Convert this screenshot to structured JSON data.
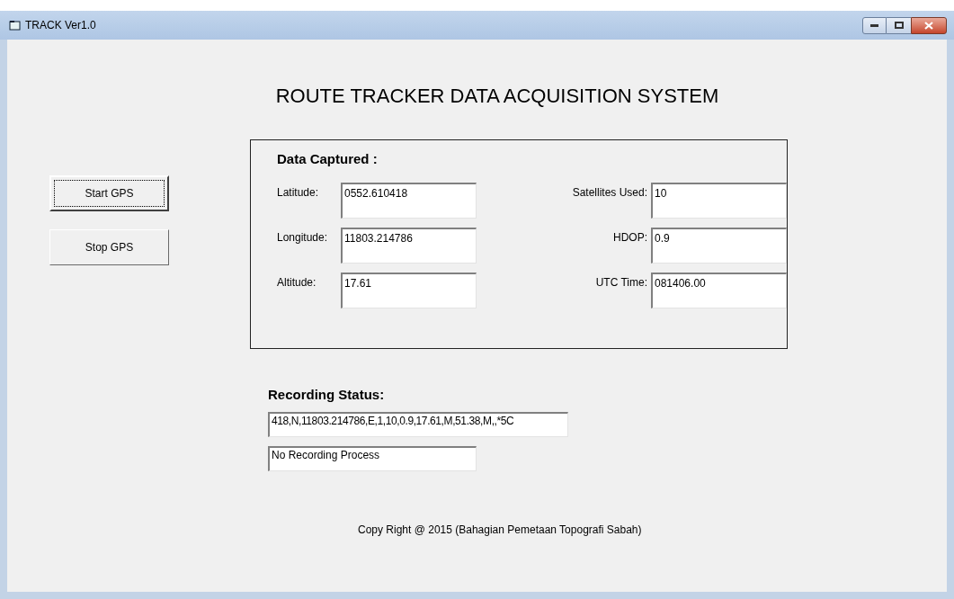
{
  "window": {
    "title": "TRACK Ver1.0"
  },
  "heading": "ROUTE TRACKER DATA ACQUISITION SYSTEM",
  "buttons": [
    {
      "label": "Start GPS",
      "focused": true
    },
    {
      "label": "Stop GPS",
      "focused": false
    }
  ],
  "data_captured": {
    "title": "Data Captured :",
    "left_fields": [
      {
        "label": "Latitude:",
        "value": "0552.610418"
      },
      {
        "label": "Longitude:",
        "value": "11803.214786"
      },
      {
        "label": "Altitude:",
        "value": "17.61"
      }
    ],
    "right_fields": [
      {
        "label": "Satellites Used:",
        "value": "10"
      },
      {
        "label": "HDOP:",
        "value": "0.9"
      },
      {
        "label": "UTC Time:",
        "value": "081406.00"
      }
    ]
  },
  "recording_status": {
    "title": "Recording Status:",
    "sentence": "418,N,11803.214786,E,1,10,0.9,17.61,M,51.38,M,,*5C",
    "status": "No Recording Process"
  },
  "footer": "Copy Right @ 2015 (Bahagian Pemetaan Topografi Sabah)"
}
